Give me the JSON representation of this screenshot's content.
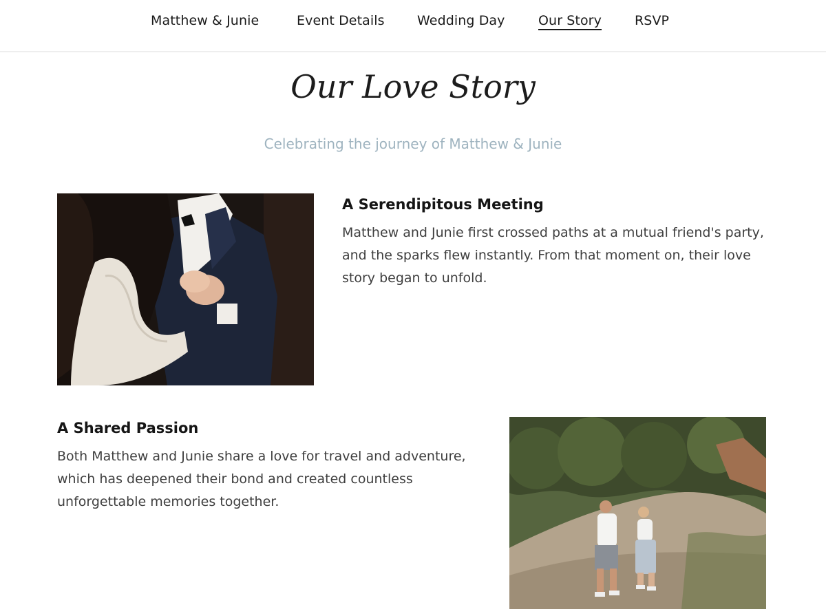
{
  "nav": {
    "items": [
      {
        "label": "Matthew & Junie"
      },
      {
        "label": "Event Details"
      },
      {
        "label": "Wedding Day"
      },
      {
        "label": "Our Story"
      },
      {
        "label": "RSVP"
      }
    ],
    "active": "Our Story"
  },
  "page": {
    "title": "Our Love Story",
    "subtitle": "Celebrating the journey of Matthew & Junie"
  },
  "stories": [
    {
      "title": "A Serendipitous Meeting",
      "text": "Matthew and Junie first crossed paths at a mutual friend's party, and the sparks flew instantly. From that moment on, their love story began to unfold."
    },
    {
      "title": "A Shared Passion",
      "text": "Both Matthew and Junie share a love for travel and adventure, which has deepened their bond and created countless unforgettable memories together."
    }
  ],
  "colors": {
    "subtitle": "#9eb3bf",
    "text": "#3e3e3e",
    "nav_divider": "#eeeeee"
  }
}
